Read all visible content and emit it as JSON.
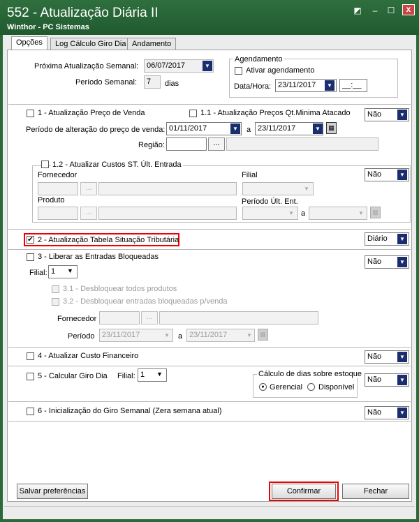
{
  "window": {
    "title": "552 - Atualização Diária II",
    "subtitle": "Winthor - PC Sistemas",
    "controls": [
      "◩",
      "–",
      "☐",
      "x"
    ]
  },
  "tabs": [
    {
      "label": "Opções",
      "active": true
    },
    {
      "label": "Log Cálculo Giro Dia",
      "active": false
    },
    {
      "label": "Andamento",
      "active": false
    }
  ],
  "top": {
    "proxima_label": "Próxima Atualização Semanal:",
    "proxima_value": "06/07/2017",
    "periodo_label": "Período Semanal:",
    "periodo_value": "7",
    "periodo_unit": "dias",
    "agendamento_title": "Agendamento",
    "ativar_label": "Ativar agendamento",
    "datahora_label": "Data/Hora:",
    "datahora_date": "23/11/2017",
    "datahora_time": "__:__"
  },
  "s1": {
    "cb1_label": "1 - Atualização Preço de Venda",
    "cb11_label": "1.1 - Atualização Preços Qt.Minima Atacado",
    "select_value": "Não",
    "periodo_label": "Período de alteração do preço de venda:",
    "date_from": "01/11/2017",
    "a_label": "a",
    "date_to": "23/11/2017",
    "regiao_label": "Região:",
    "dots": "...",
    "cb12_label": "1.2 - Atualizar Custos ST. Últ. Entrada",
    "fornecedor_label": "Fornecedor",
    "filial_label": "Filial",
    "filial_select": "Não",
    "produto_label": "Produto",
    "periodo_ult_label": "Período Últ. Ent.",
    "a2_label": "a"
  },
  "s2": {
    "label": "2 - Atualização Tabela Situação Tributária",
    "checked": "✔",
    "select_value": "Diário"
  },
  "s3": {
    "label": "3 - Liberar as Entradas Bloqueadas",
    "select_value": "Não",
    "filial_label": "Filial:",
    "filial_value": "1",
    "cb31_label": "3.1 - Desbloquear todos produtos",
    "cb32_label": "3.2 - Desbloquear entradas bloqueadas p/venda",
    "fornecedor_label": "Fornecedor",
    "periodo_label": "Período",
    "date_from": "23/11/2017",
    "a_label": "a",
    "date_to": "23/11/2017"
  },
  "s4": {
    "label": "4 - Atualizar Custo Financeiro",
    "select_value": "Não"
  },
  "s5": {
    "label": "5 - Calcular Giro Dia",
    "filial_label": "Filial:",
    "filial_value": "1",
    "calculo_title": "Cálculo de dias sobre estoque",
    "gerencial_label": "Gerencial",
    "disponivel_label": "Disponível",
    "select_value": "Não"
  },
  "s6": {
    "label": "6 - Inicialização do Giro Semanal (Zera semana atual)",
    "select_value": "Não"
  },
  "buttons": {
    "salvar": "Salvar preferências",
    "confirmar": "Confirmar",
    "fechar": "Fechar"
  },
  "colors": {
    "titlebar": "#2f6f3e",
    "highlight": "#e00000",
    "dropdown": "#1a2d6e"
  }
}
